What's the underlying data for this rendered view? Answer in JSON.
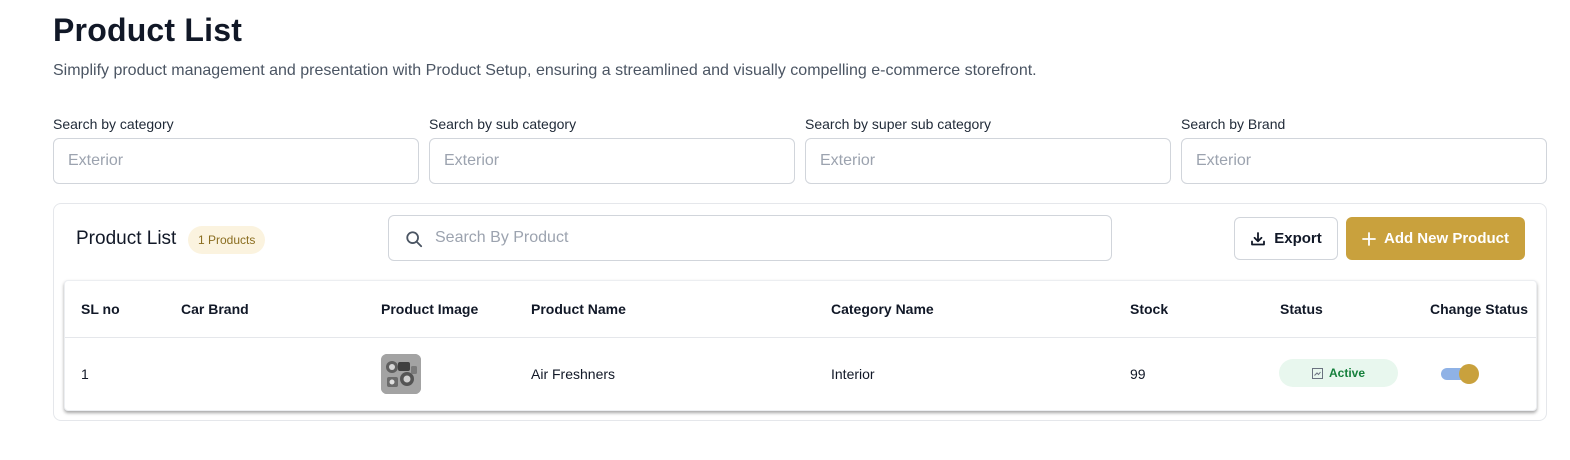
{
  "header": {
    "title": "Product List",
    "subtitle": "Simplify product management and presentation with Product Setup, ensuring a streamlined and visually compelling e-commerce storefront."
  },
  "filters": [
    {
      "label": "Search by category",
      "placeholder": "Exterior"
    },
    {
      "label": "Search by sub category",
      "placeholder": "Exterior"
    },
    {
      "label": "Search by super sub category",
      "placeholder": "Exterior"
    },
    {
      "label": "Search by Brand",
      "placeholder": "Exterior"
    }
  ],
  "product_card": {
    "title": "Product List",
    "count_badge": "1 Products",
    "search_placeholder": "Search By Product",
    "export_label": "Export",
    "add_label": "Add New Product"
  },
  "table": {
    "columns": [
      "SL no",
      "Car Brand",
      "Product Image",
      "Product Name",
      "Category Name",
      "Stock",
      "Status",
      "Change Status"
    ],
    "rows": [
      {
        "sl_no": "1",
        "car_brand": "",
        "product_name": "Air Freshners",
        "category_name": "Interior",
        "stock": "99",
        "status": "Active",
        "change_status_on": true
      }
    ]
  },
  "icons": {
    "search": "search-icon",
    "export": "download-icon",
    "add": "plus-icon",
    "status": "status-icon",
    "thumbnail": "product-thumbnail"
  },
  "colors": {
    "accent": "#c9a13d",
    "badge_bg": "#fbf3df",
    "badge_text": "#8a6d1f",
    "status_bg": "#e8f7ee",
    "status_text": "#16803c",
    "toggle_track": "#8fb2e6"
  }
}
